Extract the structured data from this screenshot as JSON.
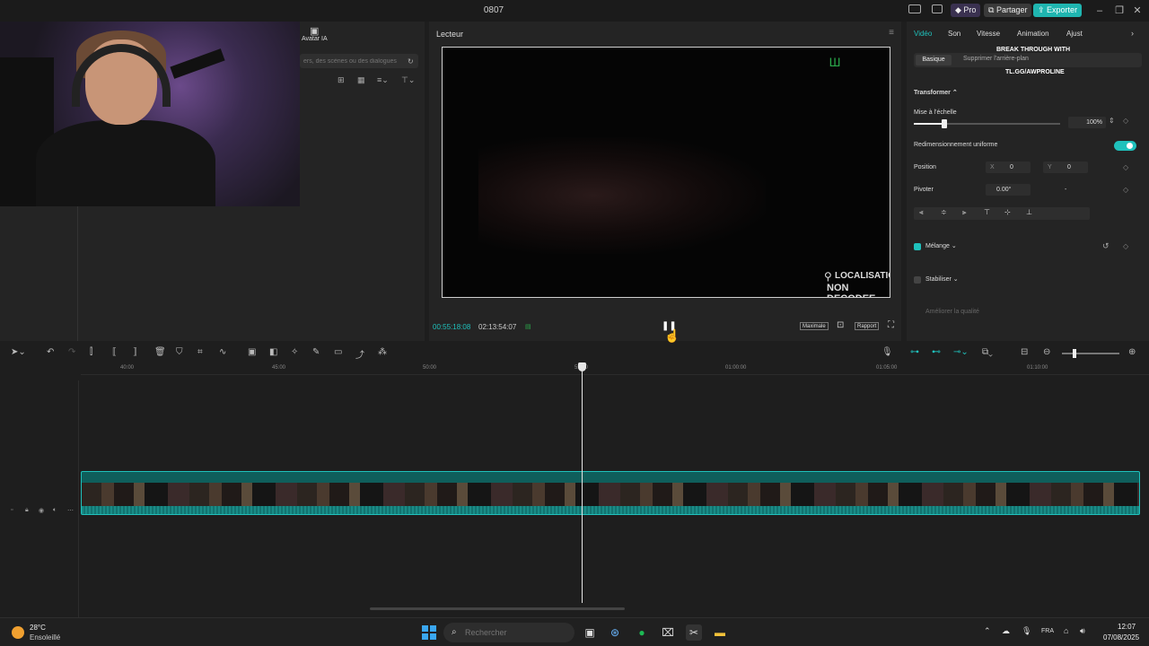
{
  "app": {
    "title": "0807"
  },
  "header": {
    "pro_label": "Pro",
    "share_label": "Partager",
    "export_label": "Exporter"
  },
  "left_panel": {
    "avatar_ia_label": "Avatar IA",
    "search_placeholder": "ers, des scènes ou des dialogues"
  },
  "player": {
    "title": "Lecteur",
    "current_time": "00:55:18:08",
    "total_time": "02:13:54:07",
    "overlay_location_line1": "LOCALISATION",
    "overlay_location_line2": "NON DECODEE",
    "max_label": "Maximale",
    "ratio_label": "Rapport"
  },
  "right_panel": {
    "tabs": [
      "Vidéo",
      "Son",
      "Vitesse",
      "Animation",
      "Ajust"
    ],
    "active_tab": "Vidéo",
    "subtabs": {
      "basic": "Basique",
      "remove": "Supprimer l'arrière-plan"
    },
    "overlay_text1": "BREAK THROUGH WITH",
    "overlay_text2": "TL.GG/AWPROLINE",
    "transform_label": "Transformer",
    "scale_label": "Mise à l'échelle",
    "scale_value": "100%",
    "scale_fraction": 0.2,
    "uniform_label": "Redimensionnement uniforme",
    "position_label": "Position",
    "pos_x_label": "X",
    "pos_x": "0",
    "pos_y_label": "Y",
    "pos_y": "0",
    "rotate_label": "Pivoter",
    "rotate_value": "0.00°",
    "rotate_dash": "-",
    "blend_label": "Mélange",
    "stabilize_label": "Stabiliser",
    "improve_label": "Améliorer la qualité"
  },
  "timeline": {
    "ticks": [
      "40:00",
      "45:00",
      "50:00",
      "55:00",
      "01:00:00",
      "01:05:00",
      "01:10:00"
    ]
  },
  "taskbar": {
    "weather_temp": "28°C",
    "weather_desc": "Ensoleillé",
    "search_placeholder": "Rechercher",
    "lang": "FRA",
    "time": "12:07",
    "date": "07/08/2025"
  }
}
